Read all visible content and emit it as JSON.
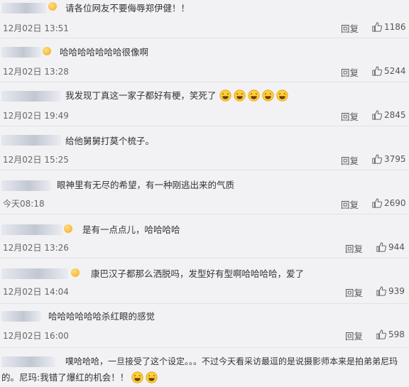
{
  "reply_label": "回复",
  "comments": [
    {
      "text": "请各位网友不要侮辱郑伊健！！",
      "time": "12月02日 13:51",
      "likes": "1186"
    },
    {
      "text": "哈哈哈哈哈哈哈很像啊",
      "time": "12月02日 13:28",
      "likes": "5244"
    },
    {
      "text": "我发现丁真这一家子都好有梗，笑死了",
      "time": "12月02日 19:49",
      "likes": "2845",
      "emoji": "laughing-emoji"
    },
    {
      "text": "给他舅舅打莫个梳子。",
      "time": "12月02日 15:25",
      "likes": "3795"
    },
    {
      "text": "眼神里有无尽的希望，有一种刚逃出来的气质",
      "time": "今天08:18",
      "likes": "2690"
    },
    {
      "text": "是有一点点儿，哈哈哈哈",
      "time": "12月02日 13:26",
      "likes": "944"
    },
    {
      "text": "康巴汉子都那么洒脱吗，发型好有型啊哈哈哈哈，爱了",
      "time": "12月02日 14:04",
      "likes": "939"
    },
    {
      "text": "哈哈哈哈哈哈杀红眼的感觉",
      "time": "12月02日 16:00",
      "likes": "598"
    },
    {
      "text": "噗哈哈哈，一旦接受了这个设定。。。不过今天看采访最逗的是说摄影师本来是拍弟弟尼玛",
      "text2": "的。尼玛:我错了爆红的机会！！",
      "emoji": "laughing-emoji"
    }
  ]
}
